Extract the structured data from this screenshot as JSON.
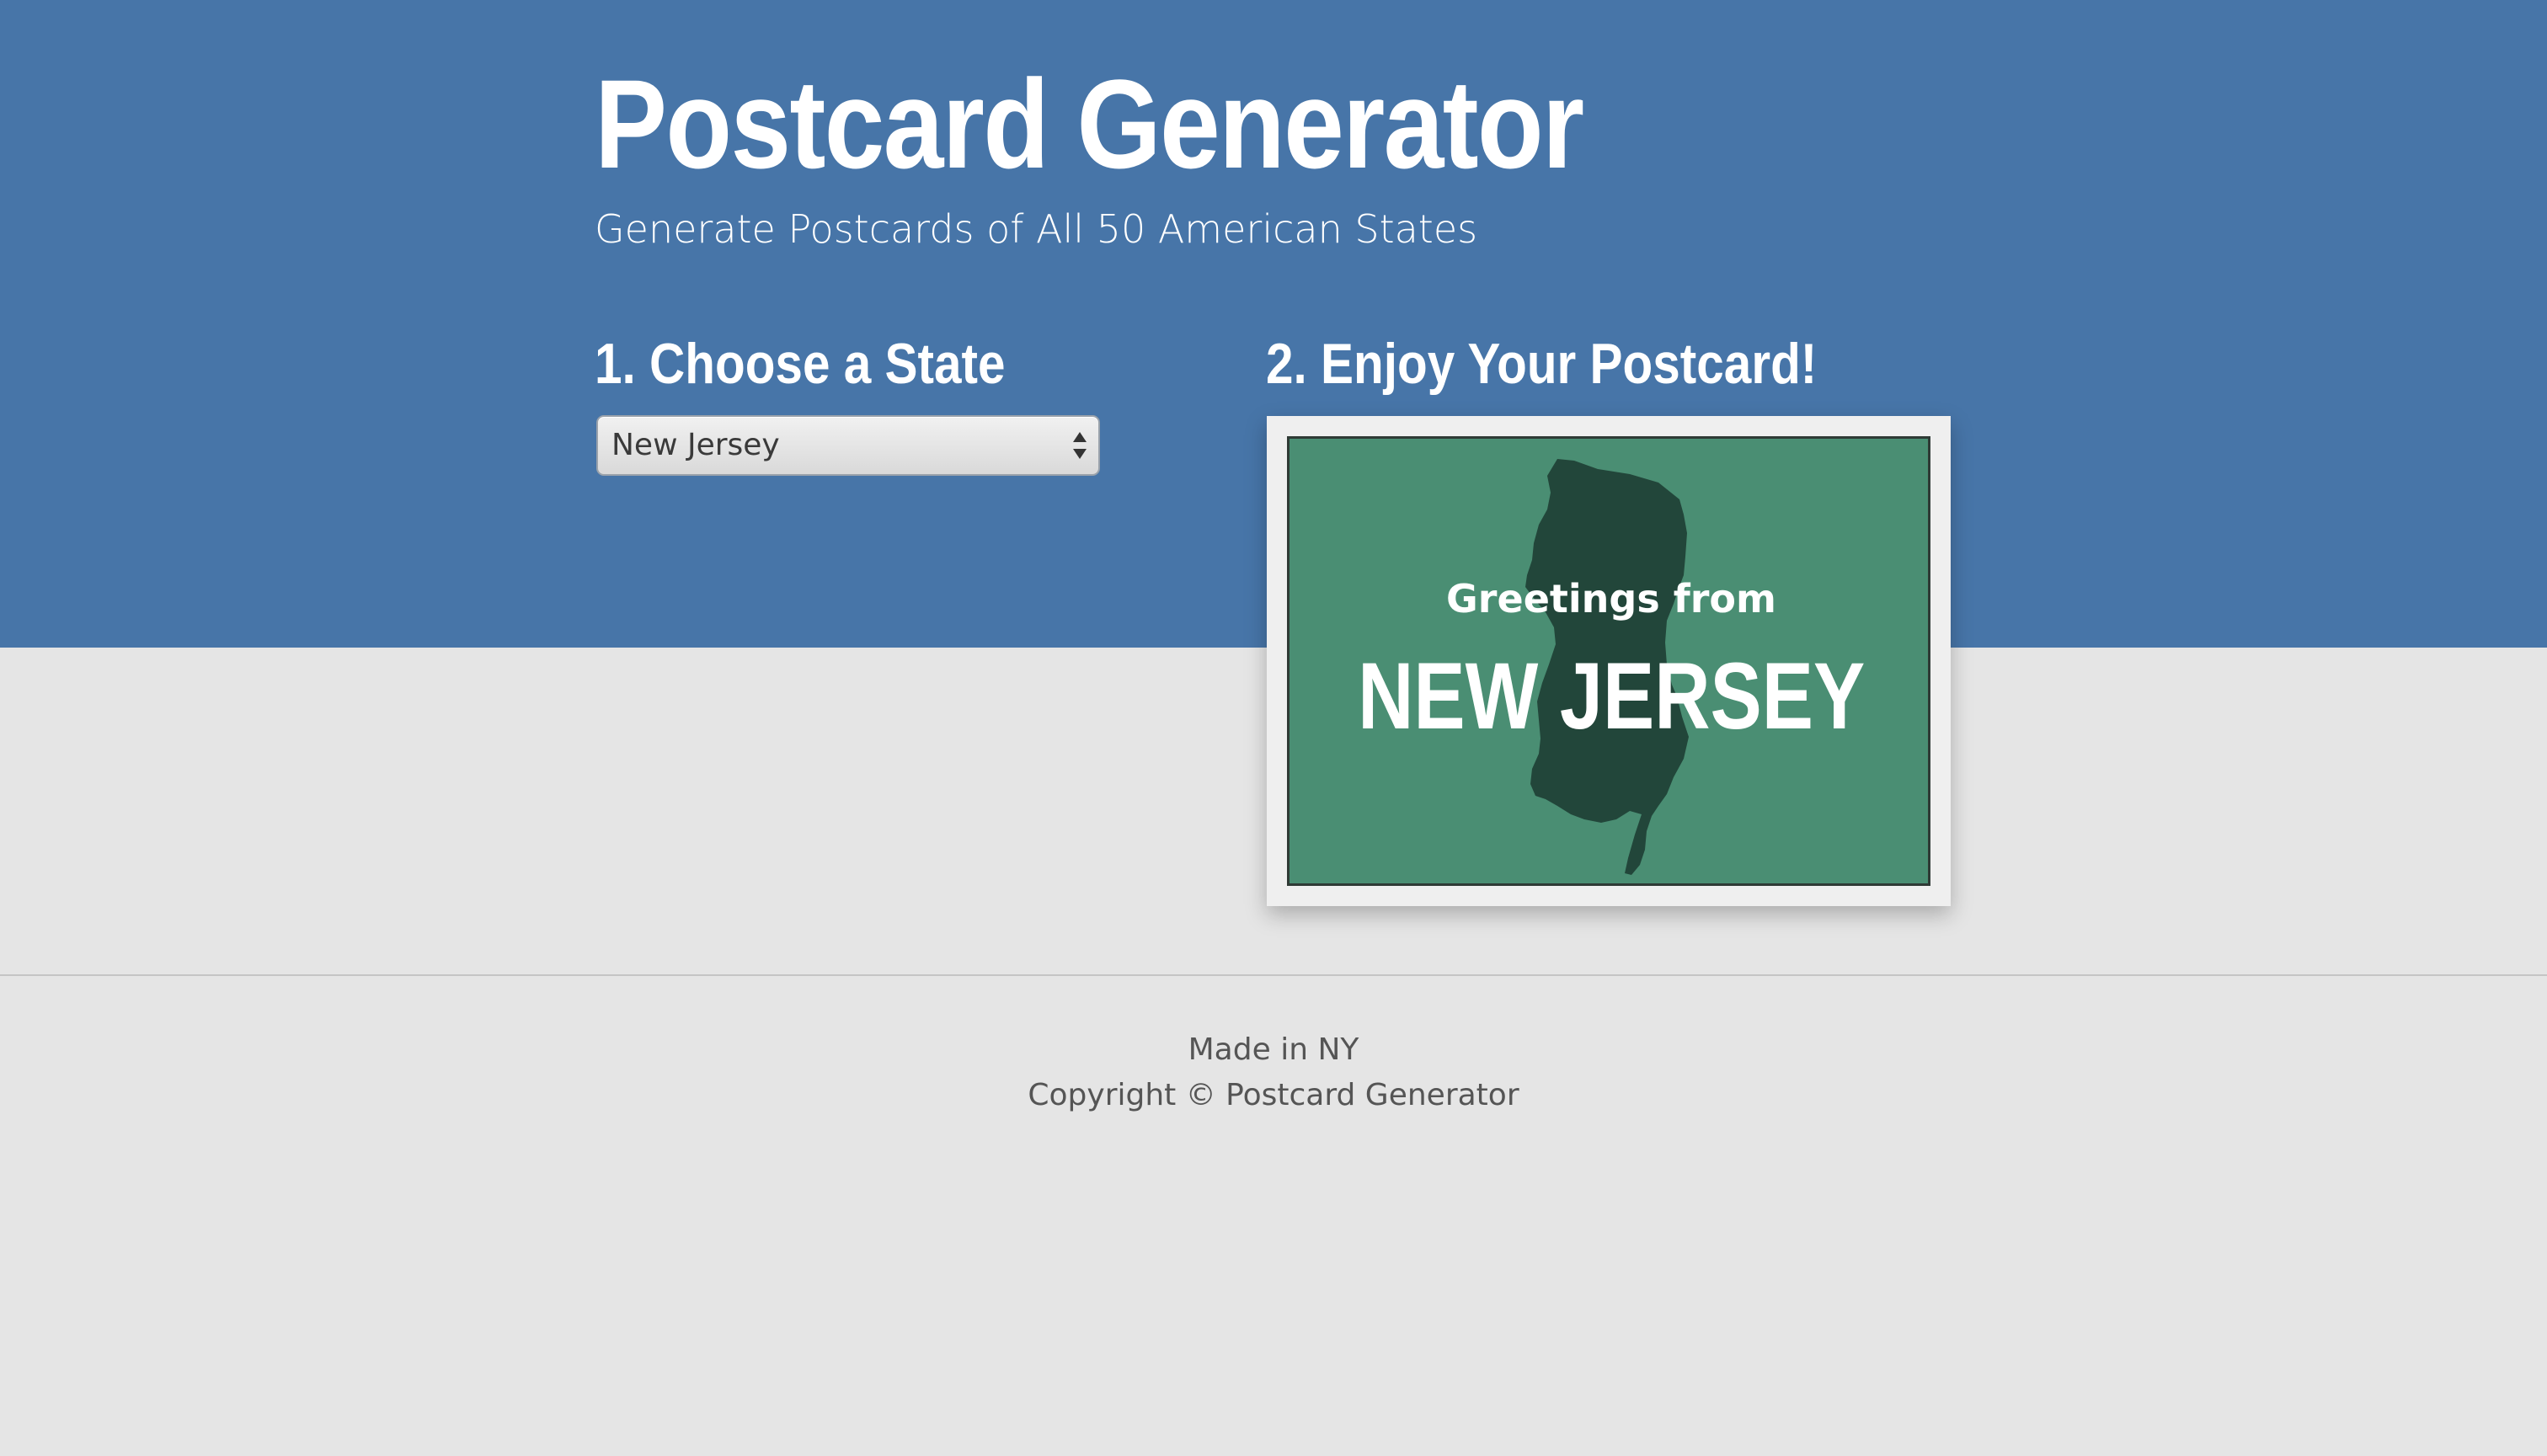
{
  "header": {
    "title": "Postcard Generator",
    "subtitle": "Generate Postcards of All 50 American States"
  },
  "steps": {
    "choose_label": "1. Choose a State",
    "enjoy_label": "2. Enjoy Your Postcard!"
  },
  "state_select": {
    "selected_value": "New Jersey"
  },
  "postcard": {
    "greeting": "Greetings from",
    "state_name": "NEW JERSEY",
    "background_color": "#4a8e73",
    "shape_color": "#22463a",
    "icon": "state-silhouette"
  },
  "footer": {
    "made_in": "Made in NY",
    "copyright": "Copyright © Postcard Generator"
  },
  "colors": {
    "hero": "#4775a8",
    "page_bg": "#e5e5e5",
    "text_light": "#ffffff"
  }
}
